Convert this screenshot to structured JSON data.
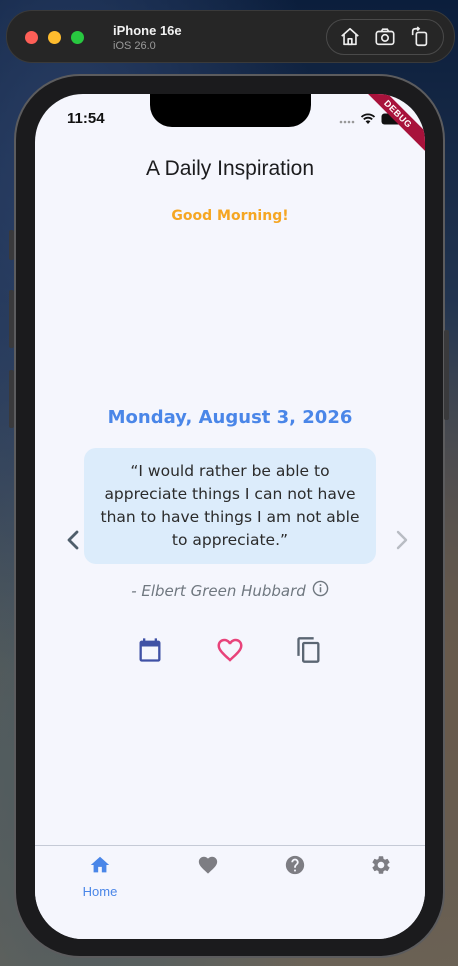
{
  "simulator": {
    "device_name": "iPhone 16e",
    "os_version": "iOS 26.0",
    "buttons": [
      "home-icon",
      "screenshot-icon",
      "rotate-icon"
    ]
  },
  "status_bar": {
    "time": "11:54",
    "debug_banner": "DEBUG"
  },
  "app": {
    "title": "A Daily Inspiration",
    "greeting": "Good Morning!",
    "date": "Monday, August 3, 2026",
    "quote": "“I would rather be able to appreciate things I can not have than to have things I am not able to appreciate.”",
    "author": "- Elbert Green Hubbard",
    "actions": [
      "calendar-icon",
      "favorite-icon",
      "copy-icon"
    ]
  },
  "bottom_nav": {
    "items": [
      {
        "icon": "home-icon",
        "label": "Home",
        "active": true
      },
      {
        "icon": "heart-icon",
        "label": "",
        "active": false
      },
      {
        "icon": "help-icon",
        "label": "",
        "active": false
      },
      {
        "icon": "settings-icon",
        "label": "",
        "active": false
      }
    ]
  },
  "colors": {
    "accent": "#4a86e8",
    "greeting": "#f5a623",
    "favorite": "#e8437a",
    "calendar": "#3f51a5",
    "quote_bg": "#dcecfb",
    "screen_bg": "#f5f6fd"
  }
}
